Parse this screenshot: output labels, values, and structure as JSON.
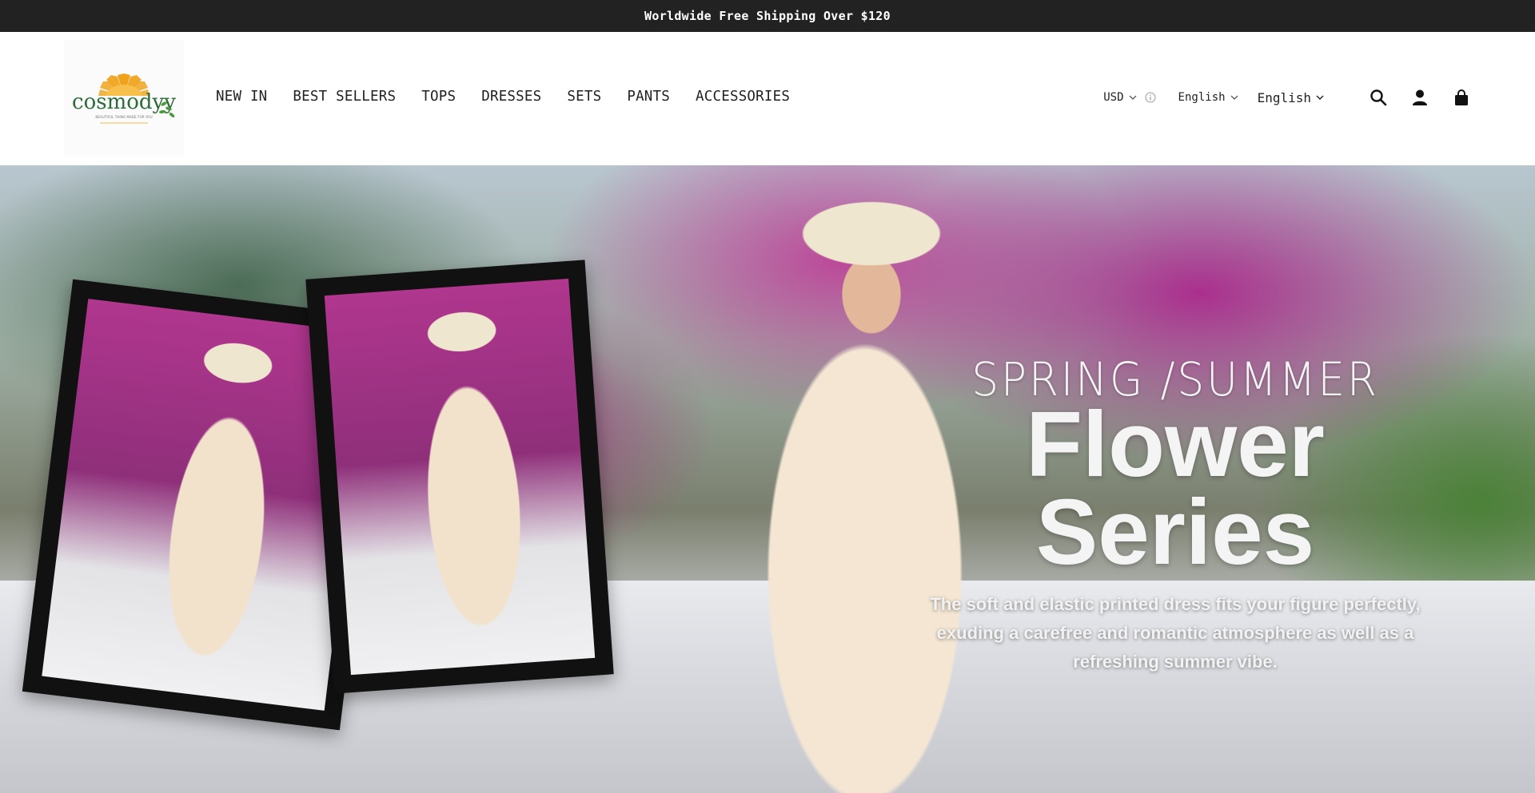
{
  "announcement": {
    "text": "Worldwide Free Shipping Over $120"
  },
  "header": {
    "logo_text": "cosmodyy",
    "logo_tagline": "BEAUTIFUL THING MADE FOR YOU",
    "nav": [
      {
        "label": "NEW IN"
      },
      {
        "label": "BEST SELLERS"
      },
      {
        "label": "TOPS"
      },
      {
        "label": "DRESSES"
      },
      {
        "label": "SETS"
      },
      {
        "label": "PANTS"
      },
      {
        "label": "ACCESSORIES"
      }
    ],
    "currency": "USD",
    "language_primary": "English",
    "language_secondary": "English",
    "icons": [
      "search-icon",
      "account-icon",
      "cart-icon"
    ]
  },
  "hero": {
    "kicker": "SPRING /SUMMER",
    "title": "Flower Series",
    "description": "The soft and elastic printed dress fits your figure perfectly, exuding a carefree and romantic atmosphere as well as a refreshing summer vibe."
  },
  "colors": {
    "announcement_bg": "#222222",
    "text": "#222222",
    "hero_text": "#f4f4f4",
    "logo_orange": "#f0a21a",
    "logo_green": "#3f8a3a"
  }
}
